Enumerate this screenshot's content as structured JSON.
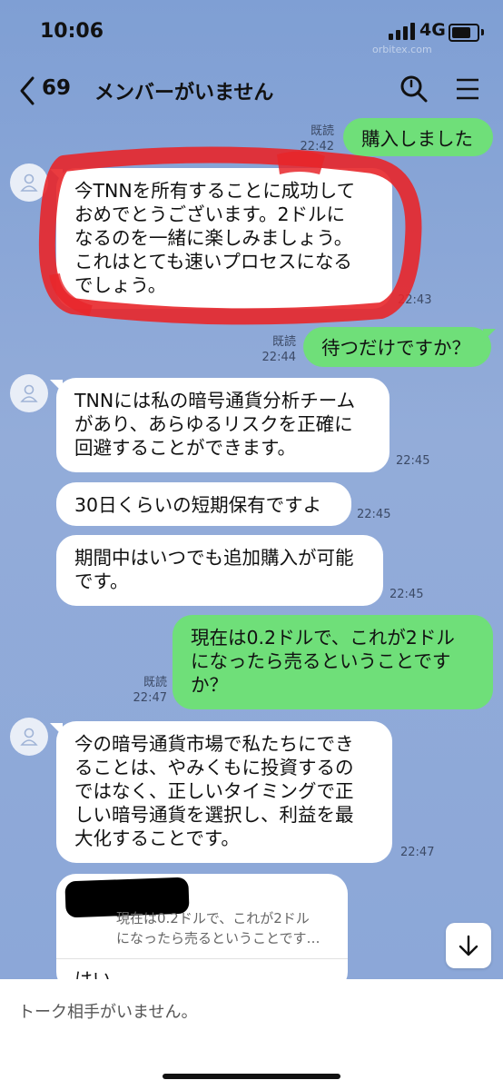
{
  "status_bar": {
    "time": "10:06",
    "network": "4G"
  },
  "ghost_url": "orbitex.com",
  "header": {
    "back_count": "69",
    "title": "メンバーがいません"
  },
  "messages": [
    {
      "type": "sent",
      "read": "既読",
      "time": "22:42",
      "text": "購入しました"
    },
    {
      "type": "received",
      "lines": [
        "今TNNを所有することに成功して",
        "おめでとうございます。2ドルに",
        "なるのを一緒に楽しみましょう。",
        "これはとても速いプロセスになる",
        "でしょう。"
      ],
      "time": "22:43"
    },
    {
      "type": "sent",
      "read": "既読",
      "time": "22:44",
      "text": "待つだけですか？"
    },
    {
      "type": "received",
      "lines": [
        "TNNには私の暗号通貨分析チーム",
        "があり、あらゆるリスクを正確に",
        "回避することができます。"
      ],
      "time": "22:45"
    },
    {
      "type": "received",
      "lines": [
        "30日くらいの短期保有ですよ"
      ],
      "time": "22:45"
    },
    {
      "type": "received",
      "lines": [
        "期間中はいつでも追加購入が可能",
        "です。"
      ],
      "time": "22:45"
    },
    {
      "type": "sent",
      "read": "既読",
      "time": "22:47",
      "lines": [
        "現在は0.2ドルで、これが2ドル",
        "になったら売るということです",
        "か？"
      ]
    },
    {
      "type": "received",
      "lines": [
        "今の暗号通貨市場で私たちにでき",
        "ることは、やみくもに投資するの",
        "ではなく、正しいタイミングで正",
        "しい暗号通貨を選択し、利益を最",
        "大化することです。"
      ],
      "time": "22:47"
    }
  ],
  "quote": {
    "lines": [
      "現在は0.2ドルで、これが2ドル",
      "になったら売るということです…"
    ],
    "partial_reply": "はい"
  },
  "footer": {
    "no_partner": "トーク相手がいません。"
  },
  "colors": {
    "sent_bubble": "#6fdf79",
    "received_bubble": "#ffffff",
    "highlight": "#e8262a"
  }
}
